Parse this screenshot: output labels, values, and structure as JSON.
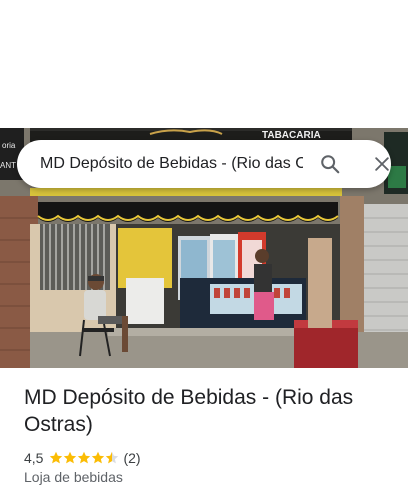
{
  "search": {
    "query": "MD Depósito de Bebidas - (Rio das Ostras)"
  },
  "photo": {
    "sign_text": "TABACARIA",
    "left_sign_text_1": "oria",
    "left_sign_text_2": "ANT"
  },
  "place": {
    "name": "MD Depósito de Bebidas - (Rio das Ostras)",
    "rating": "4,5",
    "stars": 4.5,
    "review_count": "(2)",
    "category": "Loja de bebidas"
  },
  "colors": {
    "star": "#fbbc04",
    "star_empty": "#dadce0",
    "text_primary": "#202124",
    "text_secondary": "#5f6368"
  }
}
